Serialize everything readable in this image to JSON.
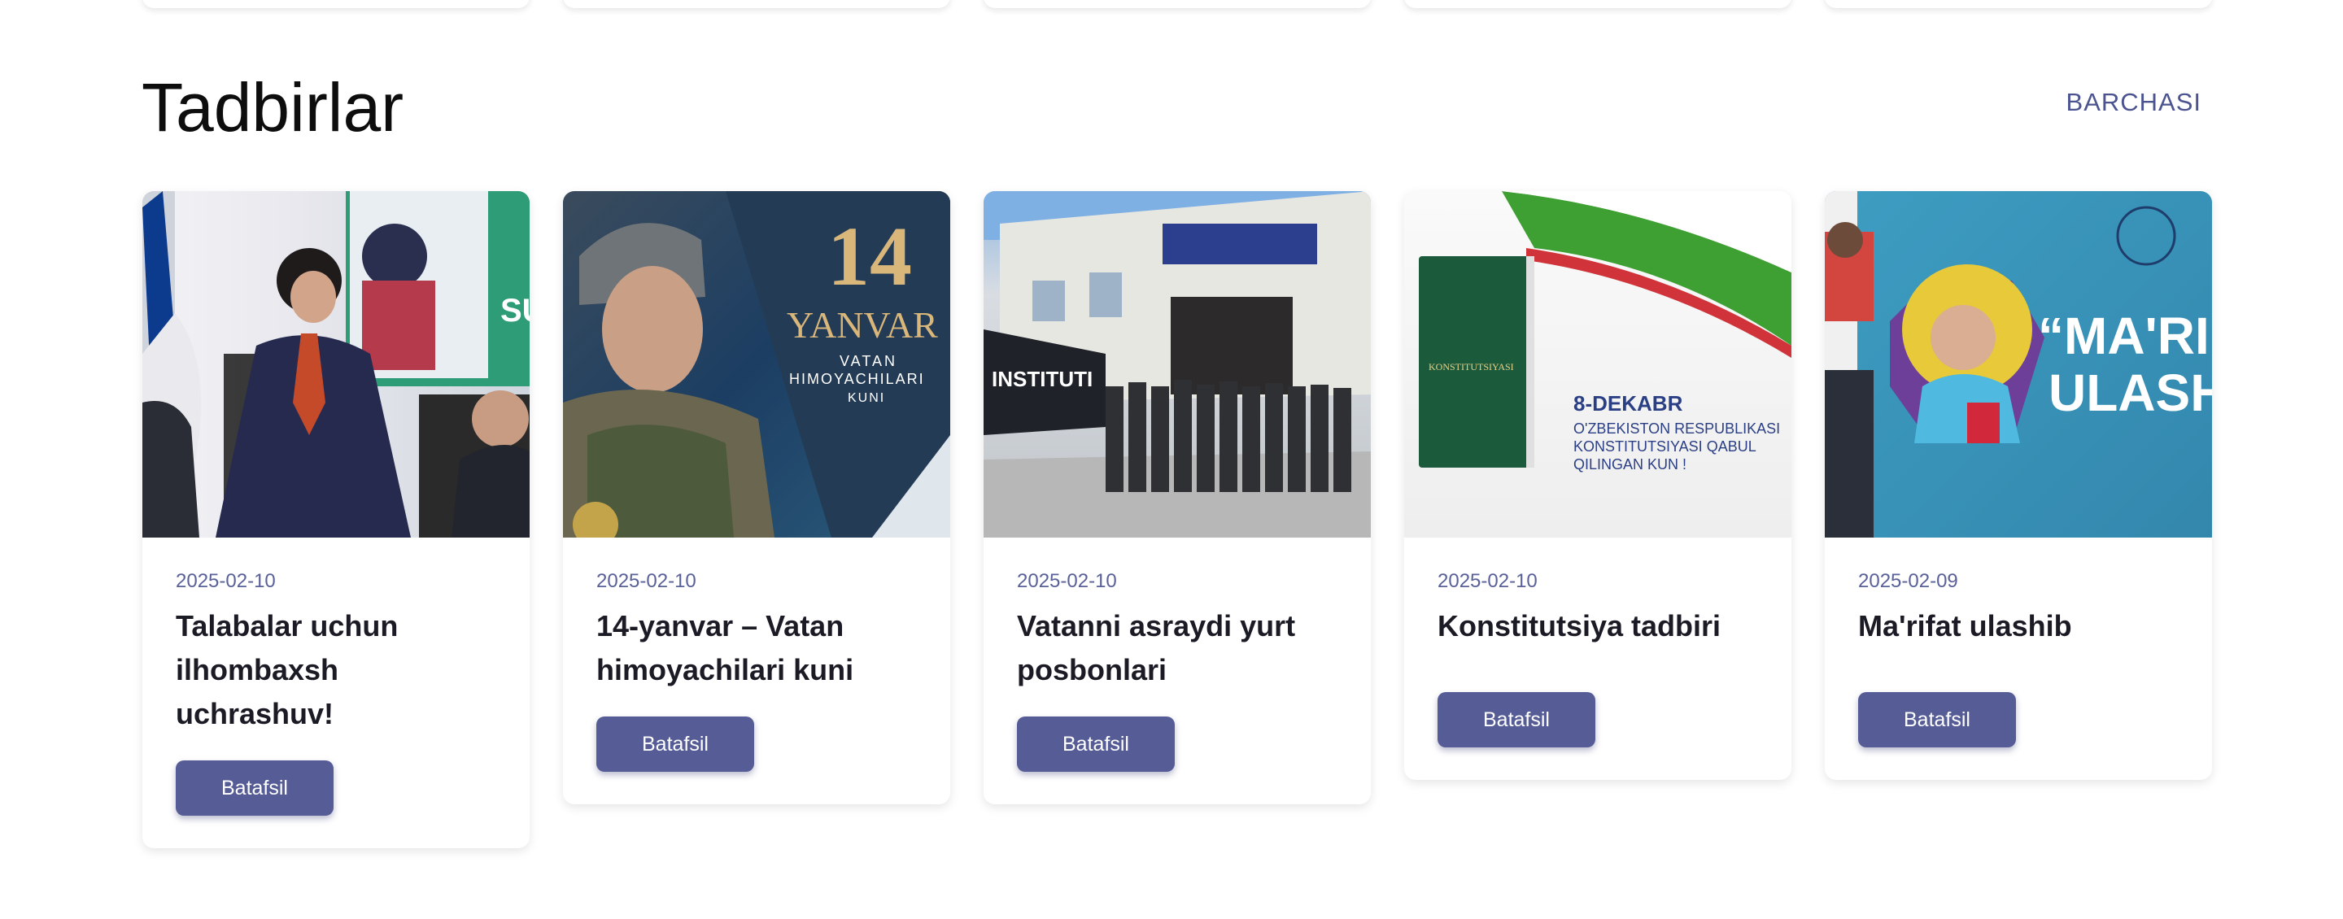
{
  "section": {
    "title": "Tadbirlar",
    "see_all": "BARCHASI"
  },
  "cards": [
    {
      "date": "2025-02-10",
      "title": "Talabalar uchun ilhombaxsh uchrashuv!",
      "button": "Batafsil",
      "image_text": "SU"
    },
    {
      "date": "2025-02-10",
      "title": "14-yanvar – Vatan himoyachilari kuni",
      "button": "Batafsil",
      "image_text": "14",
      "image_subtext": "YANVAR",
      "image_caption_1": "VATAN",
      "image_caption_2": "HIMOYACHILARI",
      "image_caption_3": "KUNI"
    },
    {
      "date": "2025-02-10",
      "title": "Vatanni asraydi yurt posbonlari",
      "button": "Batafsil",
      "image_text": "INSTITUTI"
    },
    {
      "date": "2025-02-10",
      "title": "Konstitutsiya tadbiri",
      "button": "Batafsil",
      "image_book": "KONSTITUTSIYASI",
      "image_line_1": "8-DEKABR",
      "image_line_2": "O'ZBEKISTON RESPUBLIKASI",
      "image_line_3": "KONSTITUTSIYASI QABUL",
      "image_line_4": "QILINGAN KUN !"
    },
    {
      "date": "2025-02-09",
      "title": "Ma'rifat ulashib",
      "button": "Batafsil",
      "image_line_1": "“MA'RIF",
      "image_line_2": "ULASH"
    }
  ],
  "colors": {
    "accent": "#565c96",
    "date": "#5a6199",
    "link": "#4b5390"
  }
}
